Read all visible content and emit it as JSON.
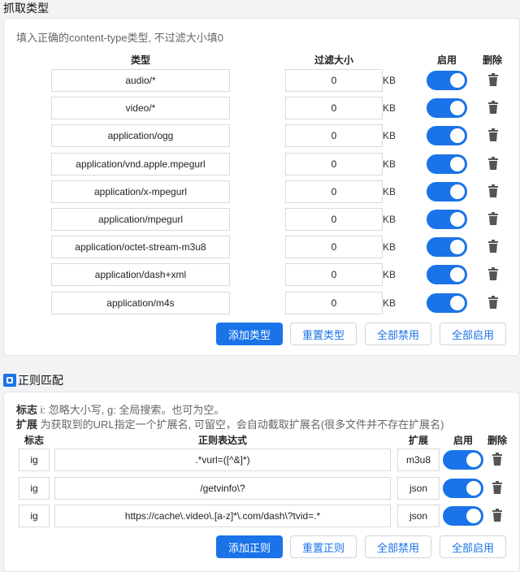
{
  "capture": {
    "title": "抓取类型",
    "hint": "填入正确的content-type类型, 不过滤大小填0",
    "headers": {
      "type": "类型",
      "size": "过滤大小",
      "enable": "启用",
      "delete": "删除"
    },
    "rows": [
      {
        "type": "audio/*",
        "size": "0",
        "unit": "KB",
        "enabled": true
      },
      {
        "type": "video/*",
        "size": "0",
        "unit": "KB",
        "enabled": true
      },
      {
        "type": "application/ogg",
        "size": "0",
        "unit": "KB",
        "enabled": true
      },
      {
        "type": "application/vnd.apple.mpegurl",
        "size": "0",
        "unit": "KB",
        "enabled": true
      },
      {
        "type": "application/x-mpegurl",
        "size": "0",
        "unit": "KB",
        "enabled": true
      },
      {
        "type": "application/mpegurl",
        "size": "0",
        "unit": "KB",
        "enabled": true
      },
      {
        "type": "application/octet-stream-m3u8",
        "size": "0",
        "unit": "KB",
        "enabled": true
      },
      {
        "type": "application/dash+xml",
        "size": "0",
        "unit": "KB",
        "enabled": true
      },
      {
        "type": "application/m4s",
        "size": "0",
        "unit": "KB",
        "enabled": true
      }
    ],
    "buttons": {
      "add": "添加类型",
      "reset": "重置类型",
      "disable_all": "全部禁用",
      "enable_all": "全部启用"
    }
  },
  "regex": {
    "title": "正则匹配",
    "hint1_label": "标志",
    "hint1": " i: 忽略大小写, g: 全局搜索。也可为空。",
    "hint2_label": "扩展",
    "hint2": " 为获取到的URL指定一个扩展名, 可留空，会自动截取扩展名(很多文件并不存在扩展名)",
    "headers": {
      "flag": "标志",
      "expr": "正则表达式",
      "ext": "扩展",
      "enable": "启用",
      "delete": "删除"
    },
    "rows": [
      {
        "flag": "ig",
        "expr": ".*vurl=([^&]*)",
        "ext": "m3u8",
        "enabled": true
      },
      {
        "flag": "ig",
        "expr": "/getvinfo\\?",
        "ext": "json",
        "enabled": true
      },
      {
        "flag": "ig",
        "expr": "https://cache\\.video\\.[a-z]*\\.com/dash\\?tvid=.*",
        "ext": "json",
        "enabled": true
      }
    ],
    "buttons": {
      "add": "添加正则",
      "reset": "重置正则",
      "disable_all": "全部禁用",
      "enable_all": "全部启用"
    }
  },
  "colors": {
    "accent": "#1a73e8"
  }
}
